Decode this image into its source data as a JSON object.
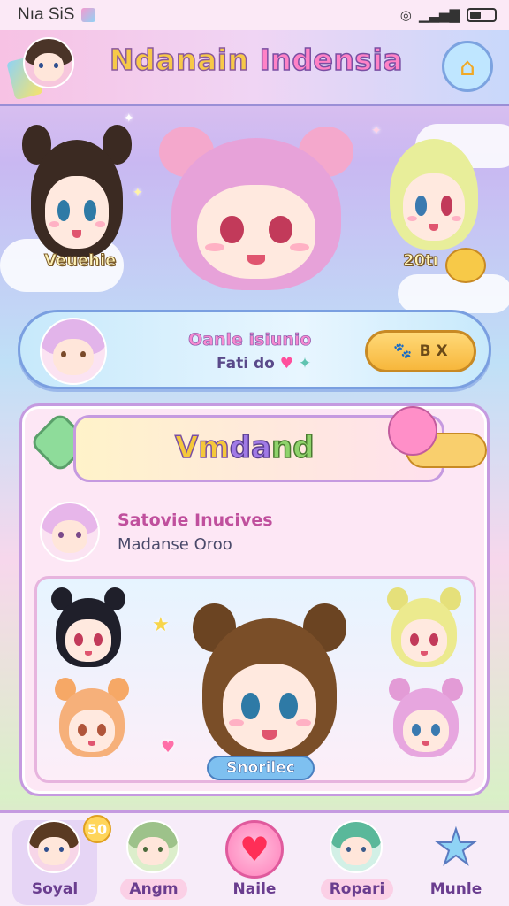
{
  "status_bar": {
    "left_text": "Nıa SiS",
    "icons": [
      "wifi-icon",
      "signal-icon",
      "battery-icon"
    ]
  },
  "header": {
    "title_part1": "Ndanain",
    "title_part2": "Indensia",
    "home_icon": "home-icon"
  },
  "hero": {
    "left_name": "Veuehie",
    "right_name": "20tı"
  },
  "banner": {
    "title": "Oanle isiunio",
    "subtitle": "Fati do",
    "heart": "♥",
    "button_label": "B X"
  },
  "panel": {
    "ribbon_y": "Vm",
    "ribbon_p": "da",
    "ribbon_g": "nd",
    "profile_name": "Satovie Inucives",
    "profile_sub": "Madanse Oroo",
    "featured_label": "Snorilec"
  },
  "nav": {
    "items": [
      {
        "label": "Soyal",
        "badge": "50"
      },
      {
        "label": "Angm"
      },
      {
        "label": "Naile"
      },
      {
        "label": "Ropari"
      },
      {
        "label": "Munle"
      }
    ]
  },
  "colors": {
    "pink": "#ff82c6",
    "yellow": "#f7c948",
    "purple": "#a07ae6",
    "blue": "#7ec0f0"
  }
}
